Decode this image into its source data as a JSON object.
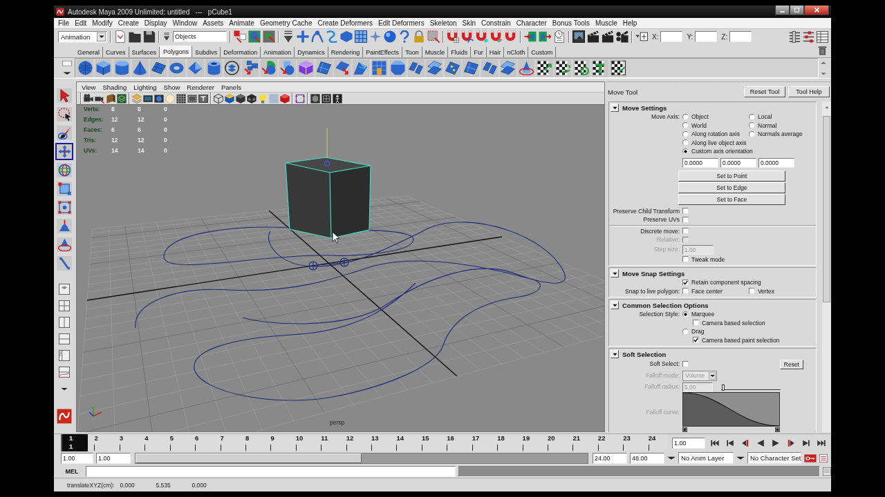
{
  "window": {
    "title": "Autodesk Maya 2009 Unlimited: untitled   ---   pCube1"
  },
  "menu_bar": [
    "File",
    "Edit",
    "Modify",
    "Create",
    "Display",
    "Window",
    "Assets",
    "Animate",
    "Geometry Cache",
    "Create Deformers",
    "Edit Deformers",
    "Skeleton",
    "Skin",
    "Constrain",
    "Character",
    "Bonus Tools",
    "Muscle",
    "Help"
  ],
  "status_line": {
    "menu_set": "Animation",
    "selection_mode": "Objects",
    "coordinates": [
      "X:",
      "Y:",
      "Z:"
    ]
  },
  "shelf": {
    "tabs": [
      {
        "label": "General",
        "selected": false
      },
      {
        "label": "Curves",
        "selected": false
      },
      {
        "label": "Surfaces",
        "selected": false
      },
      {
        "label": "Polygons",
        "selected": true
      },
      {
        "label": "Subdivs",
        "selected": false
      },
      {
        "label": "Deformation",
        "selected": false
      },
      {
        "label": "Animation",
        "selected": false
      },
      {
        "label": "Dynamics",
        "selected": false
      },
      {
        "label": "Rendering",
        "selected": false
      },
      {
        "label": "PaintEffects",
        "selected": false
      },
      {
        "label": "Toon",
        "selected": false
      },
      {
        "label": "Muscle",
        "selected": false
      },
      {
        "label": "Fluids",
        "selected": false
      },
      {
        "label": "Fur",
        "selected": false
      },
      {
        "label": "Hair",
        "selected": false
      },
      {
        "label": "nCloth",
        "selected": false
      },
      {
        "label": "Custom",
        "selected": false
      }
    ]
  },
  "toolbox": {
    "tools": [
      {
        "kind": "select",
        "selected": false
      },
      {
        "kind": "lasso",
        "selected": false
      },
      {
        "kind": "paint",
        "selected": false
      },
      {
        "kind": "move",
        "selected": true
      },
      {
        "kind": "rotate",
        "selected": false
      },
      {
        "kind": "scale",
        "selected": false
      },
      {
        "kind": "universal",
        "selected": false
      },
      {
        "kind": "soft",
        "selected": false
      },
      {
        "kind": "manipulator",
        "selected": false
      },
      {
        "kind": "last",
        "selected": false
      }
    ]
  },
  "viewport": {
    "menus": [
      "View",
      "Shading",
      "Lighting",
      "Show",
      "Renderer",
      "Panels"
    ],
    "hud": [
      {
        "label": "Verts:",
        "values": [
          "8",
          "8",
          "0"
        ]
      },
      {
        "label": "Edges:",
        "values": [
          "12",
          "12",
          "0"
        ]
      },
      {
        "label": "Faces:",
        "values": [
          "6",
          "6",
          "0"
        ]
      },
      {
        "label": "Tris:",
        "values": [
          "12",
          "12",
          "0"
        ]
      },
      {
        "label": "UVs:",
        "values": [
          "14",
          "14",
          "0"
        ]
      }
    ],
    "camera": "persp"
  },
  "tool_settings": {
    "title": "Move Tool",
    "buttons": [
      "Reset Tool",
      "Tool Help"
    ],
    "sections": [
      {
        "kind": "move",
        "title": "Move Settings",
        "expanded": true,
        "move_axis": {
          "label": "Move Axis:",
          "options": [
            {
              "label": "Object",
              "selected": false
            },
            {
              "label": "Local",
              "selected": false
            },
            {
              "label": "World",
              "selected": false
            },
            {
              "label": "Normal",
              "selected": false
            },
            {
              "label": "Along rotation axis",
              "selected": false
            },
            {
              "label": "Normals average",
              "selected": false
            },
            {
              "label": "Along live object axis",
              "selected": false
            },
            {
              "label": "Custom axis orientation",
              "selected": true
            }
          ]
        },
        "orientation": [
          "0.0000",
          "0.0000",
          "0.0000"
        ],
        "buttons": [
          "Set to Point",
          "Set to Edge",
          "Set to Face"
        ],
        "options": [
          {
            "label": "Preserve Child Transform",
            "checked": false
          },
          {
            "label": "Preserve UVs",
            "checked": false
          }
        ],
        "discrete": [
          {
            "label": "Discrete move:",
            "checked": false,
            "disabled": false
          },
          {
            "label": "Relative:",
            "checked": false,
            "disabled": true
          }
        ],
        "step_size": {
          "label": "Step size:",
          "value": "1.00",
          "disabled": true
        },
        "tweak_mode": {
          "label": "Tweak mode",
          "checked": false
        }
      },
      {
        "kind": "snap",
        "title": "Move Snap Settings",
        "expanded": true,
        "retain": {
          "label": "Retain component spacing",
          "checked": true
        },
        "snap_live": {
          "label": "Snap to live polygon:",
          "options": [
            {
              "label": "Face center",
              "checked": false
            },
            {
              "label": "Vertex",
              "checked": false
            }
          ]
        }
      },
      {
        "kind": "selection",
        "title": "Common Selection Options",
        "expanded": true,
        "style_label": "Selection Style:",
        "styles": [
          {
            "label": "Marquee",
            "selected": true,
            "option": {
              "label": "Camera based selection",
              "checked": false
            }
          },
          {
            "label": "Drag",
            "selected": false,
            "option": {
              "label": "Camera based paint selection",
              "checked": true
            }
          }
        ]
      },
      {
        "kind": "soft",
        "title": "Soft Selection",
        "expanded": true,
        "soft_select": {
          "label": "Soft Select:",
          "checked": false
        },
        "reset": "Reset",
        "falloff_mode": {
          "label": "Falloff mode:",
          "value": "Volume",
          "disabled": true
        },
        "falloff_radius": {
          "label": "Falloff radius:",
          "value": "5.00",
          "level": 0.03,
          "disabled": true
        },
        "falloff_curve": {
          "label": "Falloff curve:",
          "disabled": true
        }
      }
    ]
  },
  "time_slider": {
    "frames": [
      {
        "label": "1",
        "selected": true
      },
      {
        "label": "2",
        "selected": false
      },
      {
        "label": "3",
        "selected": false
      },
      {
        "label": "4",
        "selected": false
      },
      {
        "label": "5",
        "selected": false
      },
      {
        "label": "6",
        "selected": false
      },
      {
        "label": "7",
        "selected": false
      },
      {
        "label": "8",
        "selected": false
      },
      {
        "label": "9",
        "selected": false
      },
      {
        "label": "10",
        "selected": false
      },
      {
        "label": "11",
        "selected": false
      },
      {
        "label": "12",
        "selected": false
      },
      {
        "label": "13",
        "selected": false
      },
      {
        "label": "14",
        "selected": false
      },
      {
        "label": "15",
        "selected": false
      },
      {
        "label": "16",
        "selected": false
      },
      {
        "label": "17",
        "selected": false
      },
      {
        "label": "18",
        "selected": false
      },
      {
        "label": "19",
        "selected": false
      },
      {
        "label": "20",
        "selected": false
      },
      {
        "label": "21",
        "selected": false
      },
      {
        "label": "22",
        "selected": false
      },
      {
        "label": "23",
        "selected": false
      },
      {
        "label": "24",
        "selected": false
      }
    ],
    "current_frame": "1",
    "frame_field": "1.00"
  },
  "range_slider": {
    "start": "1.00",
    "playback_start": "1.00",
    "level": 0.5,
    "playback_end": "24.00",
    "end": "48.00",
    "anim_layer": "No Anim Layer",
    "character_set": "No Character Set"
  },
  "command_line": {
    "language": "MEL"
  },
  "help_line": {
    "label": "translateXYZ(cm):",
    "values": [
      "0.000",
      "5.535",
      "0.000"
    ]
  }
}
